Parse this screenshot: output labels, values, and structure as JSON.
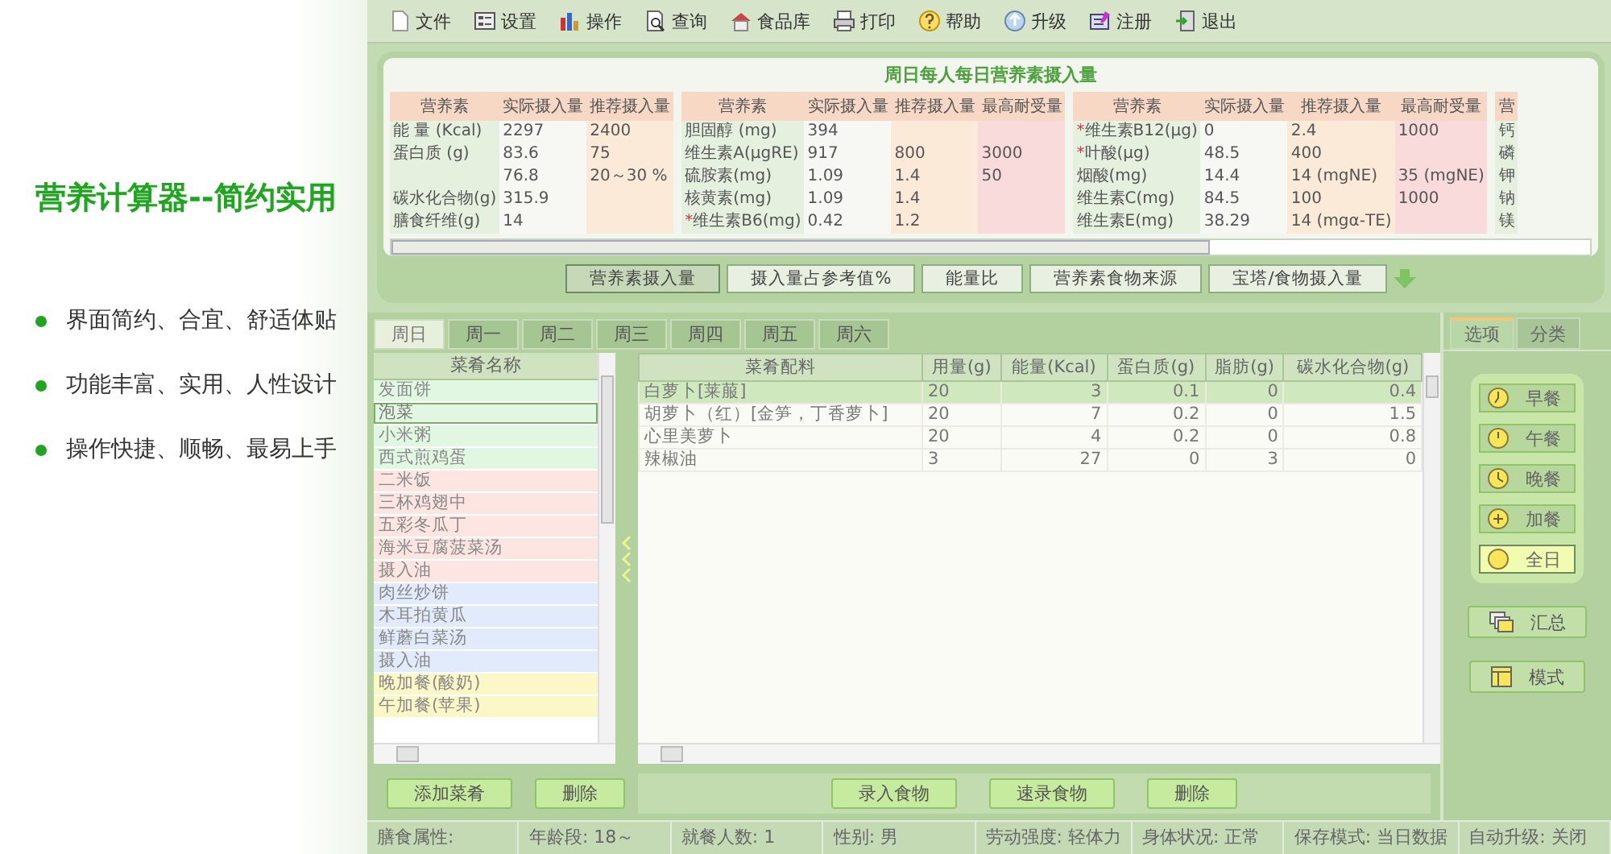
{
  "promo": {
    "title": "营养计算器--简约实用",
    "bullets": [
      "界面简约、合宜、舒适体贴",
      "功能丰富、实用、人性设计",
      "操作快捷、顺畅、最易上手"
    ]
  },
  "toolbar": [
    {
      "label": "文件"
    },
    {
      "label": "设置"
    },
    {
      "label": "操作"
    },
    {
      "label": "查询"
    },
    {
      "label": "食品库"
    },
    {
      "label": "打印"
    },
    {
      "label": "帮助"
    },
    {
      "label": "升级"
    },
    {
      "label": "注册"
    },
    {
      "label": "退出"
    }
  ],
  "nutrient_panel": {
    "title": "周日每人每日营养素摄入量",
    "tables": [
      {
        "columns": [
          "营养素",
          "实际摄入量",
          "推荐摄入量"
        ],
        "rows": [
          {
            "name": "能 量 (Kcal)",
            "actual": "2297",
            "recommended": "2400"
          },
          {
            "name": "蛋白质 (g)",
            "actual": "83.6",
            "recommended": "75"
          },
          {
            "actual": "76.8",
            "recommended": "20～30 %"
          },
          {
            "name": "碳水化合物(g)",
            "actual": "315.9"
          },
          {
            "name": "膳食纤维(g)",
            "actual": "14"
          }
        ]
      },
      {
        "columns": [
          "营养素",
          "实际摄入量",
          "推荐摄入量",
          "最高耐受量"
        ],
        "rows": [
          {
            "name": "胆固醇 (mg)",
            "actual": "394"
          },
          {
            "name": "维生素A(μgRE)",
            "actual": "917",
            "recommended": "800",
            "max": "3000"
          },
          {
            "name": "硫胺素(mg)",
            "actual": "1.09",
            "recommended": "1.4",
            "max": "50"
          },
          {
            "name": "核黄素(mg)",
            "actual": "1.09",
            "recommended": "1.4"
          },
          {
            "flag": "*",
            "name": "维生素B6(mg)",
            "actual": "0.42",
            "recommended": "1.2"
          }
        ]
      },
      {
        "columns": [
          "营养素",
          "实际摄入量",
          "推荐摄入量",
          "最高耐受量"
        ],
        "rows": [
          {
            "flag": "*",
            "name": "维生素B12(μg)",
            "actual": "0",
            "recommended": "2.4",
            "max": "1000"
          },
          {
            "flag": "*",
            "name": "叶酸(μg)",
            "actual": "48.5",
            "recommended": "400"
          },
          {
            "name": "烟酸(mg)",
            "actual": "14.4",
            "recommended": "14 (mgNE)",
            "max": "35 (mgNE)"
          },
          {
            "name": "维生素C(mg)",
            "actual": "84.5",
            "recommended": "100",
            "max": "1000"
          },
          {
            "name": "维生素E(mg)",
            "actual": "38.29",
            "recommended": "14 (mgα-TE)"
          }
        ]
      },
      {
        "columns": [
          "营"
        ],
        "rows": [
          {
            "name": "钙"
          },
          {
            "name": "磷"
          },
          {
            "name": "钾"
          },
          {
            "name": "钠"
          },
          {
            "name": "镁"
          }
        ]
      }
    ],
    "view_tabs": [
      {
        "label": "营养素摄入量",
        "selected": true
      },
      {
        "label": "摄入量占参考值%",
        "selected": false
      },
      {
        "label": "能量比",
        "selected": false
      },
      {
        "label": "营养素食物来源",
        "selected": false
      },
      {
        "label": "宝塔/食物摄入量",
        "selected": false
      }
    ]
  },
  "planner": {
    "day_tabs": [
      {
        "label": "周日",
        "selected": true
      },
      {
        "label": "周一",
        "selected": false
      },
      {
        "label": "周二",
        "selected": false
      },
      {
        "label": "周三",
        "selected": false
      },
      {
        "label": "周四",
        "selected": false
      },
      {
        "label": "周五",
        "selected": false
      },
      {
        "label": "周六",
        "selected": false
      }
    ],
    "dishes": {
      "header": "菜肴名称",
      "items": [
        {
          "name": "发面饼",
          "color": "#e2f7e2",
          "selected": false
        },
        {
          "name": "泡菜",
          "color": "#e2f7e2",
          "selected": true
        },
        {
          "name": "小米粥",
          "color": "#e2f7e2",
          "selected": false
        },
        {
          "name": "西式煎鸡蛋",
          "color": "#e2f7e2",
          "selected": false
        },
        {
          "name": "二米饭",
          "color": "#fde6e2",
          "selected": false
        },
        {
          "name": "三杯鸡翅中",
          "color": "#fde6e2",
          "selected": false
        },
        {
          "name": "五彩冬瓜丁",
          "color": "#fde6e2",
          "selected": false
        },
        {
          "name": "海米豆腐菠菜汤",
          "color": "#fde6e2",
          "selected": false
        },
        {
          "name": "摄入油",
          "color": "#fde6e2",
          "selected": false
        },
        {
          "name": "肉丝炒饼",
          "color": "#e2ebfc",
          "selected": false
        },
        {
          "name": "木耳拍黄瓜",
          "color": "#e2ebfc",
          "selected": false
        },
        {
          "name": "鲜蘑白菜汤",
          "color": "#e2ebfc",
          "selected": false
        },
        {
          "name": "摄入油",
          "color": "#e2ebfc",
          "selected": false
        },
        {
          "name": "晚加餐(酸奶)",
          "color": "#fbf7c6",
          "selected": false
        },
        {
          "name": "午加餐(苹果)",
          "color": "#fbf7c6",
          "selected": false
        }
      ]
    },
    "ingredients": {
      "columns": [
        "菜肴配料",
        "用量(g)",
        "能量(Kcal)",
        "蛋白质(g)",
        "脂肪(g)",
        "碳水化合物(g)"
      ],
      "rows": [
        {
          "cells": [
            "白萝卜[莱菔]",
            "20",
            "3",
            "0.1",
            "0",
            "0.4"
          ],
          "selected": true
        },
        {
          "cells": [
            "胡萝卜（红）[金笋，丁香萝卜]",
            "20",
            "7",
            "0.2",
            "0",
            "1.5"
          ],
          "selected": false
        },
        {
          "cells": [
            "心里美萝卜",
            "20",
            "4",
            "0.2",
            "0",
            "0.8"
          ],
          "selected": false
        },
        {
          "cells": [
            "辣椒油",
            "3",
            "27",
            "0",
            "3",
            "0"
          ],
          "selected": false
        }
      ]
    },
    "dish_buttons": [
      "添加菜肴",
      "删除"
    ],
    "ingredient_buttons": [
      "录入食物",
      "速录食物",
      "删除"
    ],
    "side_tabs": [
      {
        "label": "选项",
        "selected": true
      },
      {
        "label": "分类",
        "selected": false
      }
    ],
    "meals": [
      {
        "label": "早餐",
        "selected": false
      },
      {
        "label": "午餐",
        "selected": false
      },
      {
        "label": "晚餐",
        "selected": false
      },
      {
        "label": "加餐",
        "selected": false
      },
      {
        "label": "全日",
        "selected": true
      }
    ],
    "side_buttons": [
      "汇总",
      "模式"
    ]
  },
  "status_bar": [
    "膳食属性:",
    "年龄段: 18～",
    "就餐人数: 1",
    "性别: 男",
    "劳动强度: 轻体力",
    "身体状况: 正常",
    "保存模式: 当日数据",
    "自动升级: 关闭"
  ]
}
